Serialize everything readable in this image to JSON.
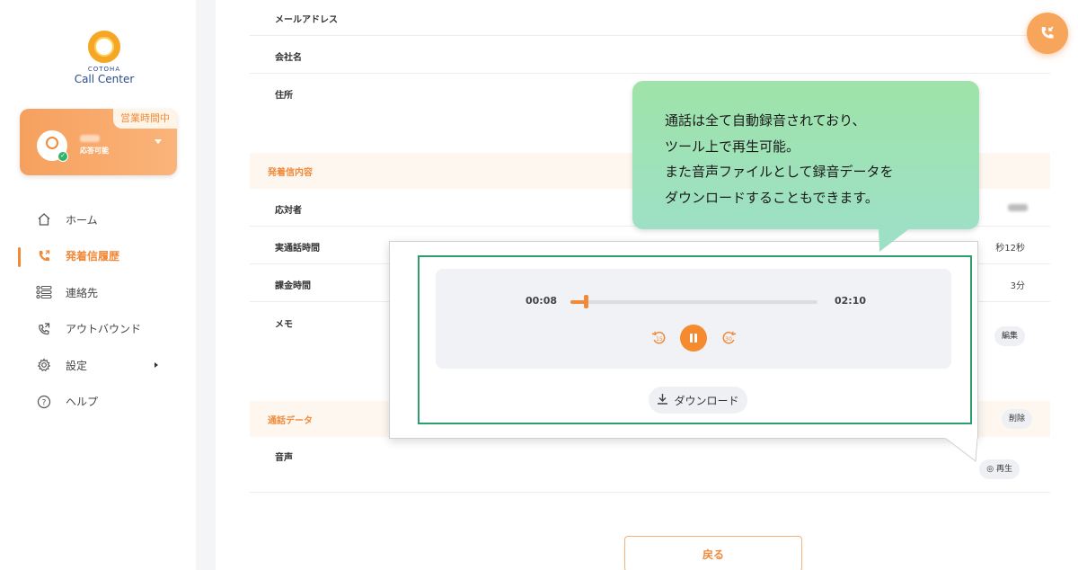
{
  "sidebar": {
    "logo_small": "COTOHA",
    "logo_big": "Call Center",
    "status_badge": "営業時間中",
    "status_text": "応答可能",
    "nav": [
      {
        "label": "ホーム",
        "icon": "home-icon"
      },
      {
        "label": "発着信履歴",
        "icon": "phone-history-icon",
        "active": true
      },
      {
        "label": "連絡先",
        "icon": "contacts-list-icon"
      },
      {
        "label": "アウトバウンド",
        "icon": "outbound-call-icon"
      },
      {
        "label": "設定",
        "icon": "gear-icon"
      },
      {
        "label": "ヘルプ",
        "icon": "help-icon"
      }
    ]
  },
  "details": {
    "email_label": "メールアドレス",
    "company_label": "会社名",
    "address_label": "住所",
    "call_section_title": "発着信内容",
    "responder_label": "応対者",
    "actual_call_time_label": "実通話時間",
    "actual_call_time_value_fragment": "秒12秒",
    "billing_time_label": "課金時間",
    "billing_time_value": "3分",
    "memo_label": "メモ",
    "memo_edit_button": "編集",
    "call_data_section_title": "通話データ",
    "delete_button": "削除",
    "voice_label": "音声",
    "play_button": "再生",
    "back_button": "戻る"
  },
  "player": {
    "current_time": "00:08",
    "total_time": "02:10",
    "progress_fraction": 0.06,
    "download_label": "ダウンロード"
  },
  "callout": {
    "lines": [
      "通話は全て自動録音されており、",
      "ツール上で再生可能。",
      "また音声ファイルとして録音データを",
      "ダウンロードすることもできます。"
    ]
  },
  "colors": {
    "accent": "#f08a3a",
    "callout_green": "#9fe3a9",
    "frame_green": "#2e9e6e"
  }
}
